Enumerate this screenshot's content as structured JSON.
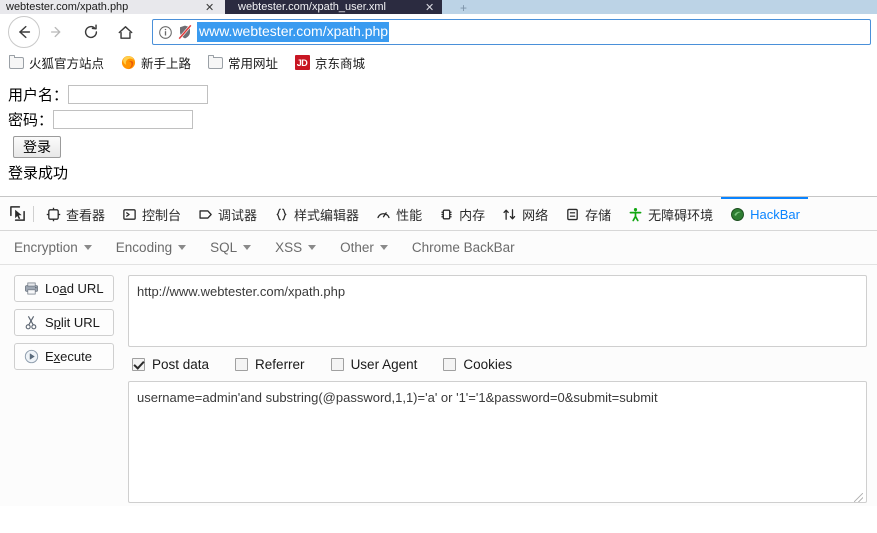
{
  "browser": {
    "tabs": [
      {
        "title": "webtester.com/xpath.php",
        "active": false,
        "close_label": "✕"
      },
      {
        "title": "webtester.com/xpath_user.xml",
        "active": true,
        "close_label": "✕"
      }
    ],
    "new_tab_label": "+",
    "nav": {
      "back_label": "←",
      "forward_label": "→",
      "reload_label": "↻",
      "home_label": "⌂"
    },
    "urlbar": {
      "identity_icon": "info-circle-icon",
      "tracking_icon": "shield-slashed-icon",
      "value": "www.webtester.com/xpath.php",
      "selected": true
    },
    "bookmarks": [
      {
        "label": "火狐官方站点",
        "icon": "folder-icon"
      },
      {
        "label": "新手上路",
        "icon": "firefox-icon"
      },
      {
        "label": "常用网址",
        "icon": "folder-icon"
      },
      {
        "label": "京东商城",
        "icon": "jd-icon",
        "icon_text": "JD"
      }
    ]
  },
  "page": {
    "username_label": "用户名：",
    "username_value": "",
    "password_label": "密码：",
    "password_value": "",
    "submit_label": "登录",
    "status_message": "登录成功"
  },
  "devtools": {
    "picker_icon": "element-picker-icon",
    "tabs": [
      {
        "label": "查看器",
        "icon": "inspector-icon",
        "active": false
      },
      {
        "label": "控制台",
        "icon": "console-icon",
        "active": false
      },
      {
        "label": "调试器",
        "icon": "debugger-icon",
        "active": false
      },
      {
        "label": "样式编辑器",
        "icon": "style-editor-icon",
        "active": false
      },
      {
        "label": "性能",
        "icon": "performance-icon",
        "active": false
      },
      {
        "label": "内存",
        "icon": "memory-icon",
        "active": false
      },
      {
        "label": "网络",
        "icon": "network-icon",
        "active": false
      },
      {
        "label": "存储",
        "icon": "storage-icon",
        "active": false
      },
      {
        "label": "无障碍环境",
        "icon": "accessibility-icon",
        "active": false
      },
      {
        "label": "HackBar",
        "icon": "hackbar-icon",
        "active": true
      }
    ],
    "accent_color": "#0a84ff"
  },
  "hackbar": {
    "menus": [
      {
        "label": "Encryption",
        "has_caret": true
      },
      {
        "label": "Encoding",
        "has_caret": true
      },
      {
        "label": "SQL",
        "has_caret": true
      },
      {
        "label": "XSS",
        "has_caret": true
      },
      {
        "label": "Other",
        "has_caret": true
      },
      {
        "label": "Chrome BackBar",
        "has_caret": false
      }
    ],
    "buttons": [
      {
        "label_pre": "Lo",
        "label_key": "a",
        "label_post": "d URL",
        "icon": "load-url-icon"
      },
      {
        "label_pre": "S",
        "label_key": "p",
        "label_post": "lit URL",
        "icon": "scissors-icon"
      },
      {
        "label_pre": "E",
        "label_key": "x",
        "label_post": "ecute",
        "icon": "play-icon"
      }
    ],
    "url_value": "http://www.webtester.com/xpath.php",
    "checkboxes": [
      {
        "label": "Post data",
        "checked": true
      },
      {
        "label": "Referrer",
        "checked": false
      },
      {
        "label": "User Agent",
        "checked": false
      },
      {
        "label": "Cookies",
        "checked": false
      }
    ],
    "post_data_value": "username=admin'and substring(@password,1,1)='a' or '1'='1&password=0&submit=submit"
  }
}
